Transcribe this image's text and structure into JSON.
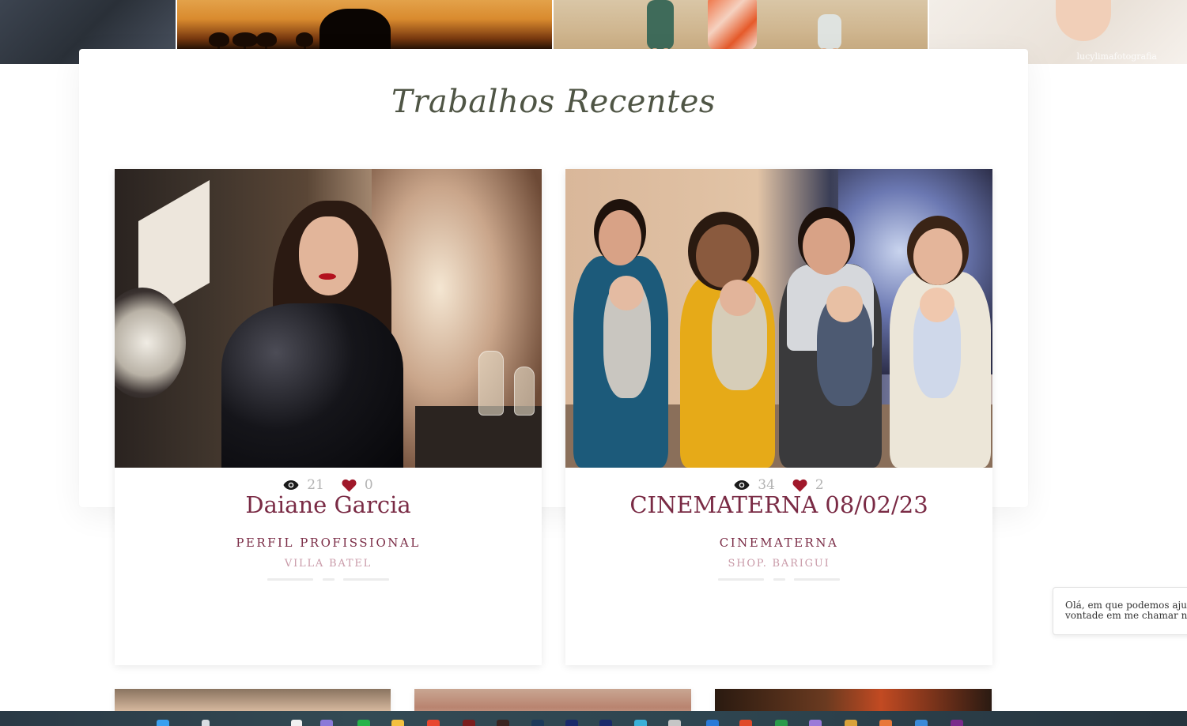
{
  "hero": {
    "credit": "lucylimafotografia"
  },
  "section": {
    "title": "Trabalhos Recentes"
  },
  "cards": [
    {
      "title": "Daiane Garcia",
      "category": "PERFIL PROFISSIONAL",
      "location": "VILLA BATEL",
      "views": "21",
      "likes": "0"
    },
    {
      "title": "CINEMATERNA 08/02/23",
      "category": "CINEMATERNA",
      "location": "SHOP. BARIGUI",
      "views": "34",
      "likes": "2"
    }
  ],
  "chat": {
    "line1": "Olá, em que podemos ajud",
    "line2": "vontade em me chamar no"
  },
  "colors": {
    "accent": "#7a2b45",
    "heart": "#a0182a",
    "muted": "#c99aa8",
    "title_script": "#4f5545"
  },
  "icons": {
    "views": "eye-icon",
    "likes": "heart-icon"
  }
}
